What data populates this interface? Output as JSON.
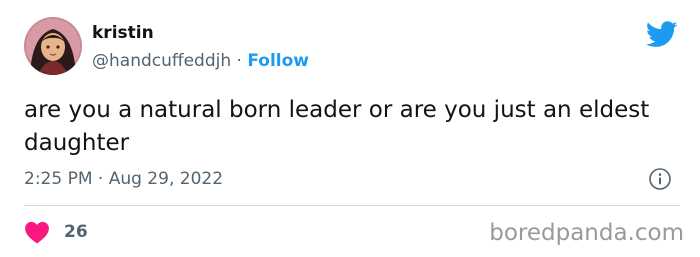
{
  "author": {
    "display_name": "kristin",
    "handle": "@handcuffeddjh",
    "separator": "·",
    "follow_label": "Follow"
  },
  "tweet": {
    "text": "are you a natural born leader or are you just an eldest daughter",
    "timestamp": "2:25 PM · Aug 29, 2022"
  },
  "engagement": {
    "likes": "26"
  },
  "watermark": "boredpanda.com",
  "icons": {
    "brand": "twitter-bird-icon",
    "info": "info-icon",
    "like": "heart-icon"
  },
  "colors": {
    "accent": "#1d9bf0",
    "like": "#f91880",
    "secondary_text": "#536471",
    "divider": "#cfd9de",
    "watermark": "#9a9a9a"
  }
}
